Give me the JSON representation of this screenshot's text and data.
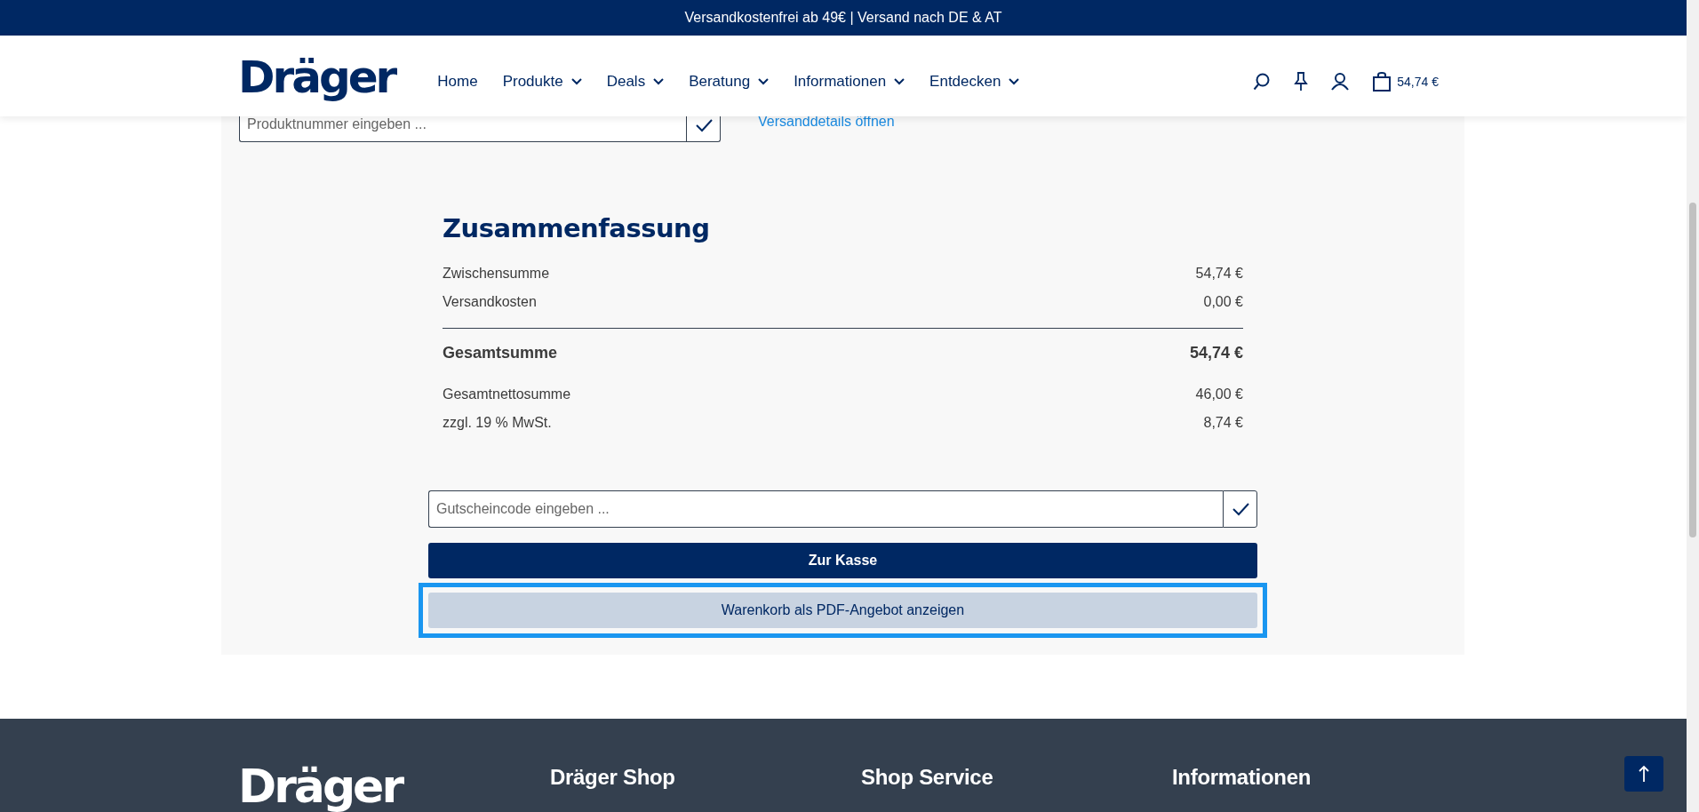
{
  "promo_bar": {
    "text": "Versandkostenfrei ab 49€ | Versand nach DE & AT"
  },
  "header": {
    "logo": "Dräger",
    "nav": [
      {
        "label": "Home",
        "has_menu": false
      },
      {
        "label": "Produkte",
        "has_menu": true
      },
      {
        "label": "Deals",
        "has_menu": true
      },
      {
        "label": "Beratung",
        "has_menu": true
      },
      {
        "label": "Informationen",
        "has_menu": true
      },
      {
        "label": "Entdecken",
        "has_menu": true
      }
    ],
    "cart_total": "54,74 €"
  },
  "quick_order": {
    "placeholder": "Produktnummer eingeben ...",
    "shipping_link": "Versanddetails öffnen"
  },
  "summary": {
    "title": "Zusammenfassung",
    "rows": [
      {
        "label": "Zwischensumme",
        "value": "54,74 €",
        "kind": "normal"
      },
      {
        "label": "Versandkosten",
        "value": "0,00 €",
        "kind": "normal"
      },
      {
        "label": "Gesamtsumme",
        "value": "54,74 €",
        "kind": "total"
      },
      {
        "label": "Gesamtnettosumme",
        "value": "46,00 €",
        "kind": "normal"
      },
      {
        "label": "zzgl. 19 % MwSt.",
        "value": "8,74 €",
        "kind": "normal"
      }
    ]
  },
  "coupon": {
    "placeholder": "Gutscheincode eingeben ..."
  },
  "buttons": [
    {
      "label": "Zur Kasse",
      "kind": "primary",
      "focused": false
    },
    {
      "label": "Warenkorb als PDF-Angebot anzeigen",
      "kind": "secondary",
      "focused": true
    }
  ],
  "footer": {
    "logo": "Dräger",
    "columns": [
      {
        "heading": "Dräger Shop"
      },
      {
        "heading": "Shop Service"
      },
      {
        "heading": "Informationen"
      }
    ]
  }
}
